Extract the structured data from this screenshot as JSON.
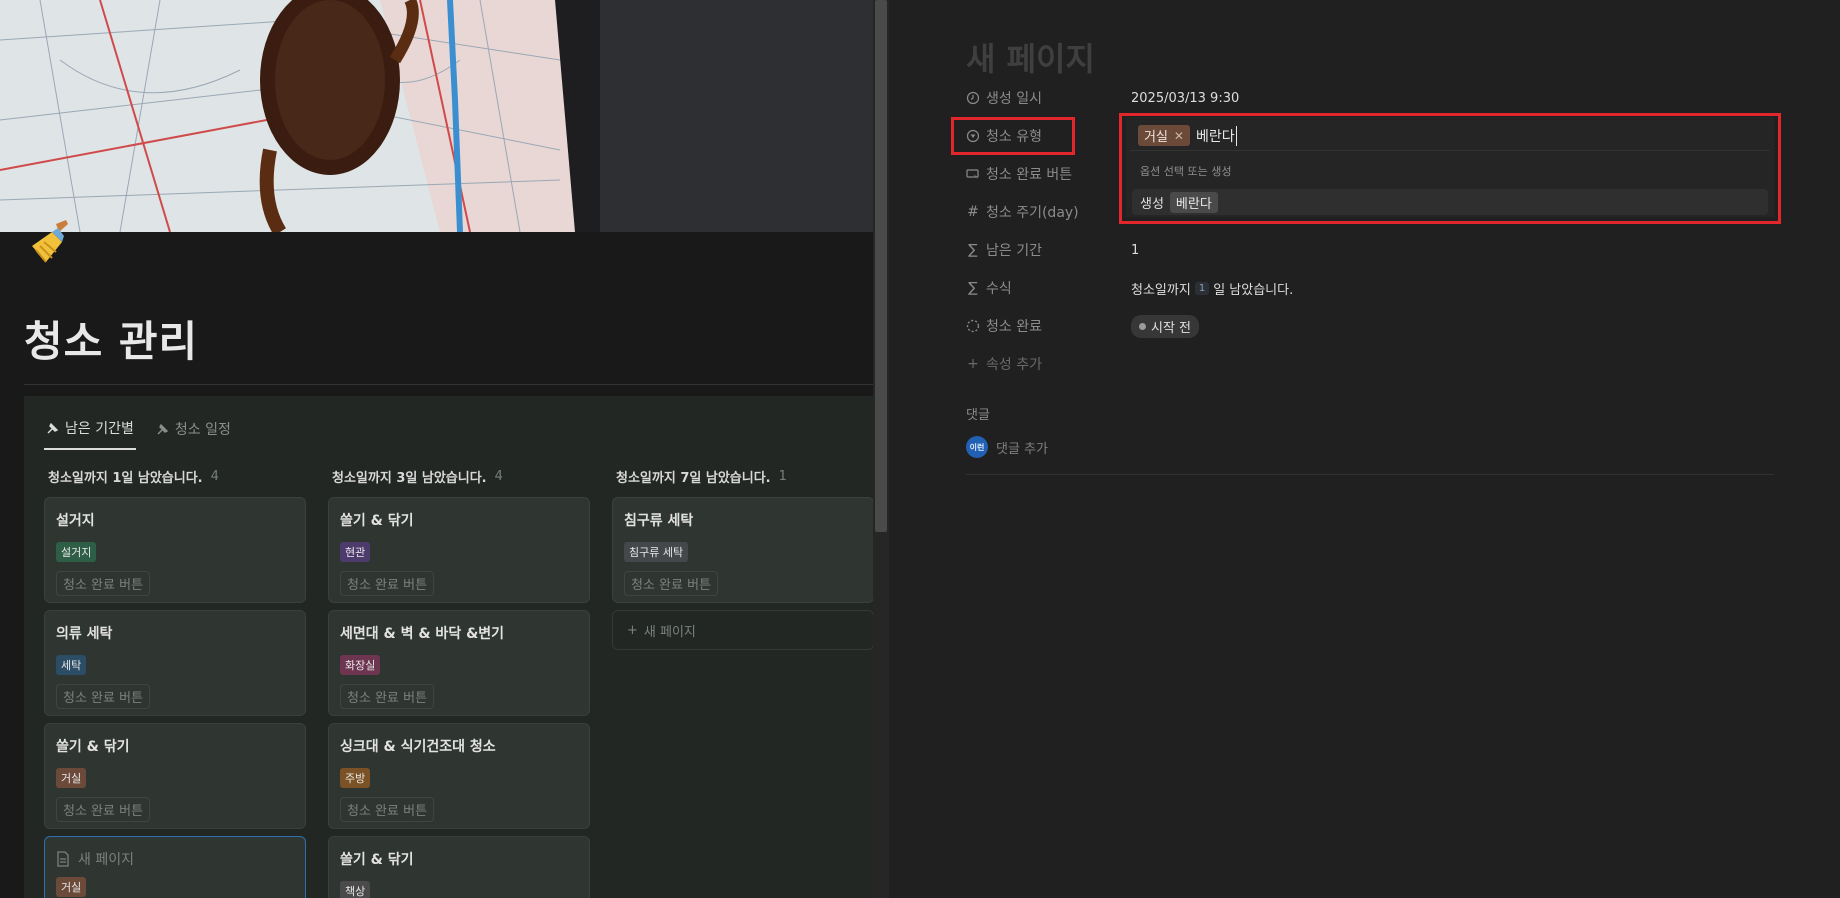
{
  "left": {
    "page_title": "청소 관리",
    "tabs": [
      {
        "label": "남은 기간별",
        "active": true
      },
      {
        "label": "청소 일정",
        "active": false
      }
    ],
    "columns": [
      {
        "header": "청소일까지 1일 남았습니다.",
        "count": "4",
        "cards": [
          {
            "title": "설거지",
            "tag": "설거지",
            "tag_color": "#2e5e46",
            "button": "청소 완료 버튼"
          },
          {
            "title": "의류 세탁",
            "tag": "세탁",
            "tag_color": "#2c4d66",
            "button": "청소 완료 버튼"
          },
          {
            "title": "쓸기 & 닦기",
            "tag": "거실",
            "tag_color": "#6b4a3a",
            "button": "청소 완료 버튼"
          }
        ],
        "new_card": {
          "title": "새 페이지",
          "tag": "거실",
          "tag_color": "#6b4a3a"
        }
      },
      {
        "header": "청소일까지 3일 남았습니다.",
        "count": "4",
        "cards": [
          {
            "title": "쓸기 & 닦기",
            "tag": "현관",
            "tag_color": "#4d3b6e",
            "button": "청소 완료 버튼"
          },
          {
            "title": "세면대 & 벽 & 바닥 &변기",
            "tag": "화장실",
            "tag_color": "#6e3550",
            "button": "청소 완료 버튼"
          },
          {
            "title": "싱크대 & 식기건조대 청소",
            "tag": "주방",
            "tag_color": "#7a5226",
            "button": "청소 완료 버튼"
          },
          {
            "title": "쓸기 & 닦기",
            "tag": "책상",
            "tag_color": "#4a4a4a",
            "button": ""
          }
        ]
      },
      {
        "header": "청소일까지 7일 남았습니다.",
        "count": "1",
        "cards": [
          {
            "title": "침구류 세탁",
            "tag": "침구류 세탁",
            "tag_color": "#45484a",
            "button": "청소 완료 버튼"
          }
        ],
        "add_label": "새 페이지"
      }
    ]
  },
  "right": {
    "title": "새 페이지",
    "props": {
      "created": {
        "label": "생성 일시",
        "value": "2025/03/13 9:30"
      },
      "type": {
        "label": "청소 유형",
        "selected_chip": "거실",
        "typed_text": "베란다"
      },
      "button": {
        "label": "청소 완료 버튼"
      },
      "cycle": {
        "label": "청소 주기(day)"
      },
      "remaining": {
        "label": "남은 기간",
        "value": "1"
      },
      "formula": {
        "label": "수식",
        "prefix": "청소일까지",
        "num": "1",
        "suffix": "일 남았습니다."
      },
      "done": {
        "label": "청소 완료",
        "value": "시작 전"
      },
      "add_prop": {
        "label": "속성 추가"
      }
    },
    "select_popup": {
      "hint": "옵션 선택 또는 생성",
      "create_label": "생성",
      "create_value": "베란다"
    },
    "comments": {
      "heading": "댓글",
      "avatar": "이런",
      "add_label": "댓글 추가"
    }
  },
  "colors": {
    "highlight": "#e3262c",
    "accent_blue": "#2f6fb0"
  }
}
